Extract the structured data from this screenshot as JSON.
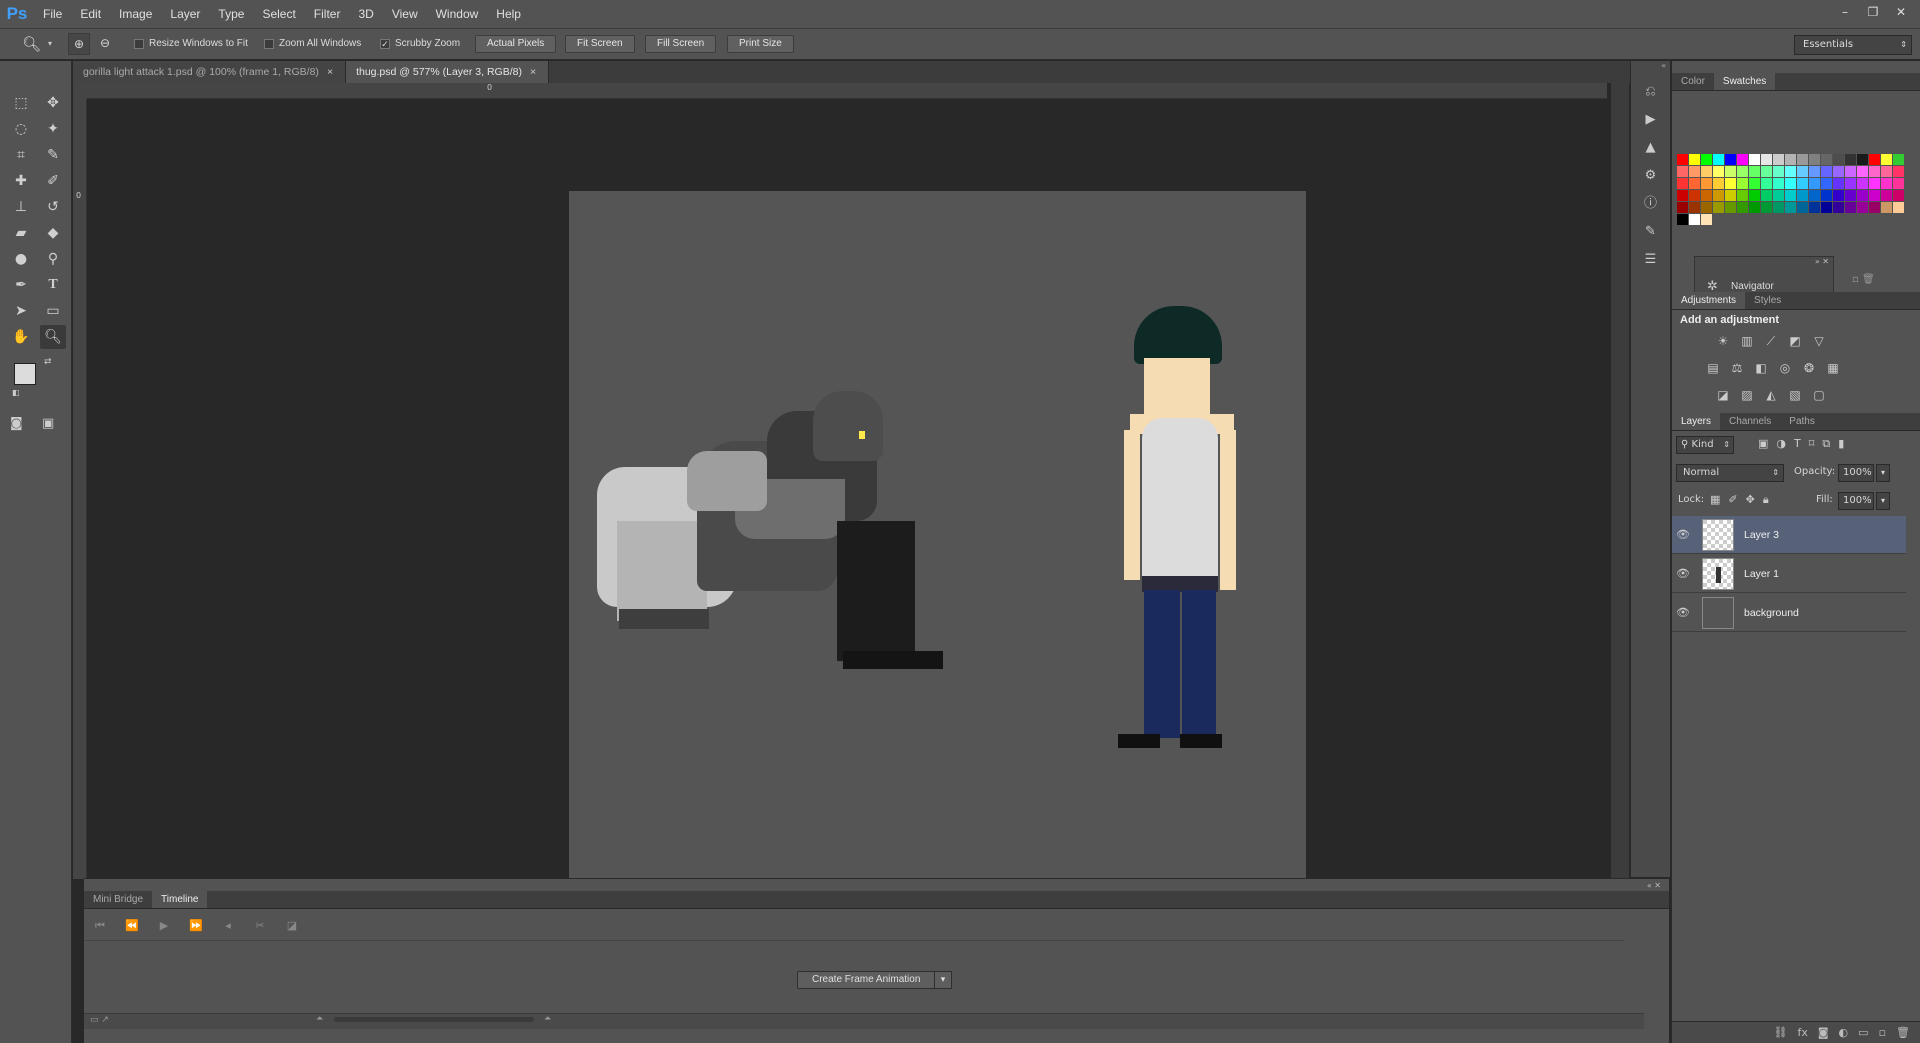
{
  "app": {
    "logo": "Ps"
  },
  "menu": [
    "File",
    "Edit",
    "Image",
    "Layer",
    "Type",
    "Select",
    "Filter",
    "3D",
    "View",
    "Window",
    "Help"
  ],
  "window_controls": [
    "–",
    "❐",
    "✕"
  ],
  "options_bar": {
    "resize_windows": "Resize Windows to Fit",
    "zoom_all": "Zoom All Windows",
    "scrubby_zoom": "Scrubby Zoom",
    "actual_pixels": "Actual Pixels",
    "fit_screen": "Fit Screen",
    "fill_screen": "Fill Screen",
    "print_size": "Print Size",
    "workspace": "Essentials"
  },
  "doc_tabs": [
    {
      "label": "gorilla light attack 1.psd @ 100% (frame 1, RGB/8)",
      "close": "×"
    },
    {
      "label": "thug.psd @ 577% (Layer 3, RGB/8)",
      "close": "×"
    }
  ],
  "rulers": {
    "top_zero": "0",
    "left_zero": "0"
  },
  "color_panel": {
    "tabs": [
      "Color",
      "Swatches"
    ],
    "swatches": [
      "#ff0000",
      "#ffff00",
      "#00ff00",
      "#00ffff",
      "#0000ff",
      "#ff00ff",
      "#ffffff",
      "#e6e6e6",
      "#cccccc",
      "#b3b3b3",
      "#999999",
      "#808080",
      "#666666",
      "#4d4d4d",
      "#333333",
      "#1a1a1a",
      "#ff0000",
      "#ffff33",
      "#33cc33",
      "#ff6666",
      "#ff9966",
      "#ffcc66",
      "#ffff66",
      "#ccff66",
      "#99ff66",
      "#66ff66",
      "#66ff99",
      "#66ffcc",
      "#66ffff",
      "#66ccff",
      "#6699ff",
      "#6666ff",
      "#9966ff",
      "#cc66ff",
      "#ff66ff",
      "#ff66cc",
      "#ff6699",
      "#ff3366",
      "#ff3333",
      "#ff6633",
      "#ff9933",
      "#ffcc33",
      "#ffff33",
      "#99ff33",
      "#33ff33",
      "#33ff99",
      "#33ffcc",
      "#33ffff",
      "#33ccff",
      "#3399ff",
      "#3366ff",
      "#6633ff",
      "#9933ff",
      "#cc33ff",
      "#ff33ff",
      "#ff33cc",
      "#ff3399",
      "#cc0000",
      "#cc3300",
      "#cc6600",
      "#cc9900",
      "#cccc00",
      "#66cc00",
      "#00cc00",
      "#00cc66",
      "#00cc99",
      "#00cccc",
      "#0099cc",
      "#0066cc",
      "#0033cc",
      "#3300cc",
      "#6600cc",
      "#9900cc",
      "#cc00cc",
      "#cc0099",
      "#cc0066",
      "#990000",
      "#993300",
      "#996600",
      "#999900",
      "#669900",
      "#339900",
      "#009900",
      "#009933",
      "#009966",
      "#009999",
      "#006699",
      "#003399",
      "#000099",
      "#330099",
      "#660099",
      "#990099",
      "#990066",
      "#cc9966",
      "#ffcc99",
      "#000000",
      "#ffffff",
      "#ffe4b5"
    ],
    "navigator_label": "Navigator"
  },
  "adjustments": {
    "tabs": [
      "Adjustments",
      "Styles"
    ],
    "title": "Add an adjustment",
    "icons_row1": [
      "brightness-icon",
      "levels-icon",
      "curves-icon",
      "exposure-icon",
      "vibrance-icon"
    ],
    "icons_row2": [
      "hue-saturation-icon",
      "color-balance-icon",
      "black-white-icon",
      "photo-filter-icon",
      "channel-mixer-icon",
      "color-lookup-icon"
    ],
    "icons_row3": [
      "invert-icon",
      "posterize-icon",
      "threshold-icon",
      "gradient-map-icon",
      "selective-color-icon"
    ]
  },
  "layers_panel": {
    "tabs": [
      "Layers",
      "Channels",
      "Paths"
    ],
    "kind": "Kind",
    "blend_mode": "Normal",
    "opacity_label": "Opacity:",
    "opacity_value": "100%",
    "lock_label": "Lock:",
    "fill_label": "Fill:",
    "fill_value": "100%",
    "layers": [
      {
        "name": "Layer 3",
        "selected": true
      },
      {
        "name": "Layer 1",
        "selected": false
      },
      {
        "name": "background",
        "selected": false
      }
    ]
  },
  "bottom_panel": {
    "tabs": [
      "Mini Bridge",
      "Timeline"
    ],
    "create_button": "Create Frame Animation"
  },
  "colors": {
    "canvas_bg": "#555555",
    "gorilla_light": "#c6c6c6",
    "gorilla_dark": "#3a3a3a",
    "beanie": "#0e2a26",
    "skin": "#f6dcb2",
    "tank_top": "#dcdcdc",
    "jeans": "#1b2a5c",
    "selection_blue": "#576279"
  }
}
